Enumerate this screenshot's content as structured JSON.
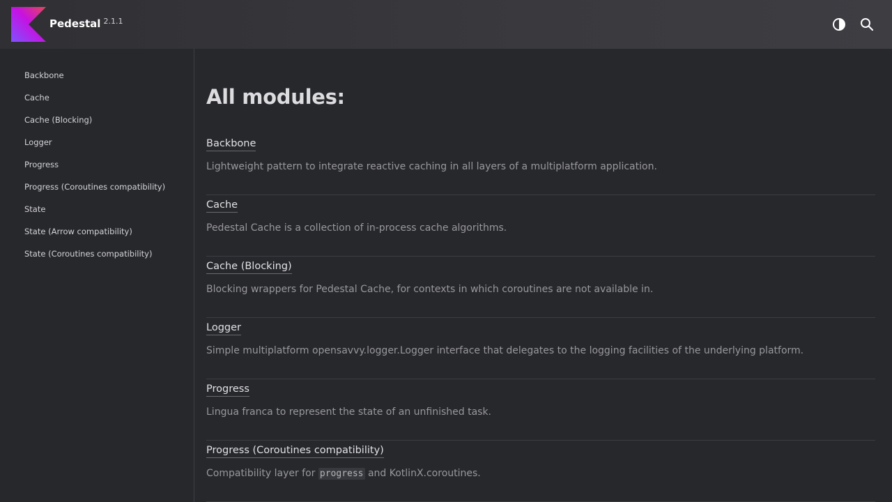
{
  "header": {
    "brand_name": "Pedestal",
    "version": "2.1.1",
    "icons": {
      "logo": "kotlin-logo-icon",
      "theme": "half-circle-contrast-icon",
      "search": "search-icon"
    },
    "colors": {
      "background": "#3a3a3e",
      "logo_gradient": [
        "#7f52ff",
        "#e44857"
      ]
    }
  },
  "sidebar": {
    "items": [
      {
        "label": "Backbone"
      },
      {
        "label": "Cache"
      },
      {
        "label": "Cache (Blocking)"
      },
      {
        "label": "Logger"
      },
      {
        "label": "Progress"
      },
      {
        "label": "Progress (Coroutines compatibility)"
      },
      {
        "label": "State"
      },
      {
        "label": "State (Arrow compatibility)"
      },
      {
        "label": "State (Coroutines compatibility)"
      }
    ]
  },
  "main": {
    "title": "All modules:",
    "modules": [
      {
        "name": "Backbone",
        "description": "Lightweight pattern to integrate reactive caching in all layers of a multiplatform application."
      },
      {
        "name": "Cache",
        "description": "Pedestal Cache is a collection of in-process cache algorithms."
      },
      {
        "name": "Cache (Blocking)",
        "description": "Blocking wrappers for Pedestal Cache, for contexts in which coroutines are not available in."
      },
      {
        "name": "Logger",
        "description": "Simple multiplatform opensavvy.logger.Logger interface that delegates to the logging facilities of the underlying platform."
      },
      {
        "name": "Progress",
        "description": "Lingua franca to represent the state of an unfinished task."
      },
      {
        "name": "Progress (Coroutines compatibility)",
        "description_before": "Compatibility layer for ",
        "description_code": "progress",
        "description_after": " and KotlinX.coroutines."
      }
    ]
  },
  "colors": {
    "page_background": "#27282c",
    "text_primary": "#e2e2e5",
    "text_secondary": "#98989d",
    "divider": "#3d3e43"
  }
}
